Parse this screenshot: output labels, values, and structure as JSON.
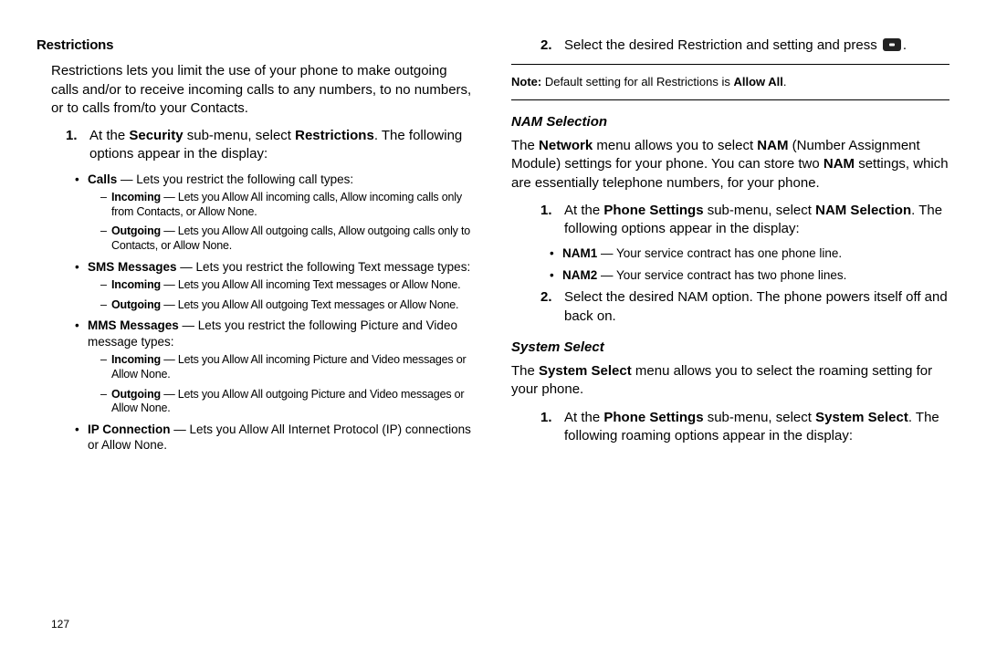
{
  "left": {
    "heading": "Restrictions",
    "intro": "Restrictions lets you limit the use of your phone to make outgoing calls and/or to receive incoming calls to any numbers, to no numbers, or to calls from/to your Contacts.",
    "step1_pre": "At the ",
    "step1_b1": "Security",
    "step1_mid": " sub-menu, select ",
    "step1_b2": "Restrictions",
    "step1_post": ". The following options appear in the display:",
    "calls_b": "Calls",
    "calls_t": " — Lets you restrict the following call types:",
    "calls_in_b": "Incoming",
    "calls_in_t": " — Lets you Allow All incoming calls, Allow incoming calls only from Contacts, or Allow None.",
    "calls_out_b": "Outgoing",
    "calls_out_t": " — Lets you Allow All outgoing calls, Allow outgoing calls only to Contacts, or Allow None.",
    "sms_b": "SMS Messages",
    "sms_t": " — Lets you restrict the following Text message types:",
    "sms_in_b": "Incoming",
    "sms_in_t": " — Lets you Allow All incoming Text messages or Allow None.",
    "sms_out_b": "Outgoing",
    "sms_out_t": " — Lets you Allow All outgoing Text messages or Allow None.",
    "mms_b": "MMS Messages",
    "mms_t": " — Lets you restrict the following Picture and Video message types:",
    "mms_in_b": "Incoming",
    "mms_in_t": " — Lets you Allow All incoming Picture and Video messages or Allow None.",
    "mms_out_b": "Outgoing",
    "mms_out_t": " — Lets you Allow All outgoing Picture and Video messages or Allow None.",
    "ip_b": "IP Connection",
    "ip_t": " — Lets you Allow All Internet Protocol (IP) connections or Allow None.",
    "pagenum": "127"
  },
  "right": {
    "step2_num": "2.",
    "step2_text": "Select the desired Restriction and setting and press ",
    "step2_post": ".",
    "note_b1": "Note:",
    "note_mid": " Default setting for all Restrictions is ",
    "note_b2": "Allow All",
    "note_post": ".",
    "nam_heading": "NAM Selection",
    "nam_intro_pre": "The ",
    "nam_intro_b1": "Network",
    "nam_intro_mid1": " menu allows you to select ",
    "nam_intro_b2": "NAM",
    "nam_intro_mid2": " (Number Assignment Module) settings for your phone. You can store two ",
    "nam_intro_b3": "NAM",
    "nam_intro_post": " settings, which are essentially telephone numbers, for your phone.",
    "nam_step1_pre": "At the ",
    "nam_step1_b1": "Phone Settings",
    "nam_step1_mid": " sub-menu, select ",
    "nam_step1_b2": "NAM Selection",
    "nam_step1_post": ". The following options appear in the display:",
    "nam1_b": "NAM1",
    "nam1_t": " — Your service contract has one phone line.",
    "nam2_b": "NAM2",
    "nam2_t": " — Your service contract has two phone lines.",
    "nam_step2": "Select the desired NAM option. The phone powers itself off and back on.",
    "sys_heading": "System Select",
    "sys_intro_pre": "The ",
    "sys_intro_b1": "System Select",
    "sys_intro_post": " menu allows you to select the roaming setting for your phone.",
    "sys_step1_pre": "At the ",
    "sys_step1_b1": "Phone Settings",
    "sys_step1_mid": " sub-menu, select ",
    "sys_step1_b2": "System Select",
    "sys_step1_post": ". The following roaming options appear in the display:"
  }
}
